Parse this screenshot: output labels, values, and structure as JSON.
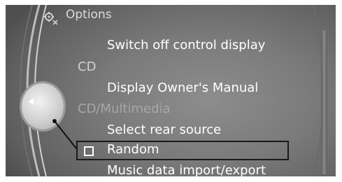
{
  "menu": {
    "title": "Options",
    "items": [
      {
        "label": "Switch off control display",
        "kind": "item"
      },
      {
        "label": "CD",
        "kind": "header"
      },
      {
        "label": "Display Owner's Manual",
        "kind": "item"
      },
      {
        "label": "CD/Multimedia",
        "kind": "header"
      },
      {
        "label": "Select rear source",
        "kind": "item"
      },
      {
        "label": "Random",
        "kind": "item",
        "checkbox": true,
        "checked": false,
        "selected": true
      },
      {
        "label": "Music data import/export",
        "kind": "item"
      }
    ]
  },
  "icons": {
    "title": "options-gear-icon",
    "controller": "controller-knob-icon",
    "controller_direction": "left-arrow-icon"
  },
  "colors": {
    "screen": "#7a7a7a",
    "text": "#ffffff",
    "header_text": "#d2d2d2",
    "selection": "#1a1a1a"
  }
}
